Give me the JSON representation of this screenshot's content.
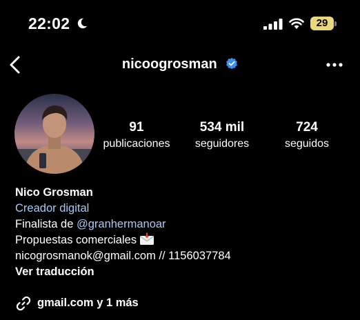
{
  "status_bar": {
    "time": "22:02",
    "battery_level": "29",
    "icons": [
      "moon-icon",
      "signal-icon",
      "wifi-icon",
      "battery-icon"
    ]
  },
  "header": {
    "username": "nicoogrosman",
    "verified": true,
    "icons": [
      "back-icon",
      "verified-icon",
      "more-icon"
    ]
  },
  "stats": [
    {
      "value": "91",
      "label": "publicaciones"
    },
    {
      "value": "534 mil",
      "label": "seguidores"
    },
    {
      "value": "724",
      "label": "seguidos"
    }
  ],
  "bio": {
    "name": "Nico Grosman",
    "category": "Creador digital",
    "line1_prefix": "Finalista de ",
    "line1_mention": "@granhermanoar",
    "line2": "Propuestas comerciales",
    "line3": "nicogrosmanok@gmail.com // 1156037784",
    "translate": "Ver traducción"
  },
  "link": {
    "text": "gmail.com y 1 más",
    "icon": "link-icon"
  },
  "colors": {
    "background": "#000000",
    "text": "#ffffff",
    "link_blue": "#a9c9f2",
    "verified_blue": "#3a8ef0",
    "battery_yellow": "#e9d87e"
  }
}
